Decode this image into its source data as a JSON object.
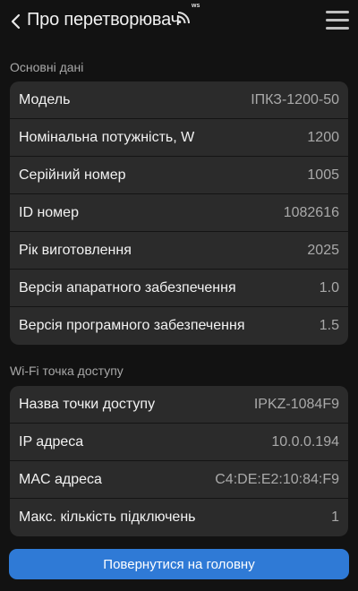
{
  "header": {
    "title": "Про перетворювач",
    "back_icon": "chevron-left-icon",
    "ws_icon": "wifi-websocket-icon",
    "ws_label": "ws",
    "menu_icon": "hamburger-menu-icon"
  },
  "basic": {
    "title": "Основні дані",
    "rows": [
      {
        "label": "Модель",
        "value": "ІПКЗ-1200-50"
      },
      {
        "label": "Номінальна потужність, W",
        "value": "1200"
      },
      {
        "label": "Серійний номер",
        "value": "1005"
      },
      {
        "label": "ID номер",
        "value": "1082616"
      },
      {
        "label": "Рік виготовлення",
        "value": "2025"
      },
      {
        "label": "Версія апаратного забезпечення",
        "value": "1.0"
      },
      {
        "label": "Версія програмного забезпечення",
        "value": "1.5"
      }
    ]
  },
  "wifi": {
    "title": "Wi-Fi точка доступу",
    "rows": [
      {
        "label": "Назва точки доступу",
        "value": "IPKZ-1084F9"
      },
      {
        "label": "IP адреса",
        "value": "10.0.0.194"
      },
      {
        "label": "MAC адреса",
        "value": "C4:DE:E2:10:84:F9"
      },
      {
        "label": "Макс. кількість підключень",
        "value": "1"
      }
    ]
  },
  "footer": {
    "home_button": "Повернутися на головну"
  },
  "colors": {
    "background": "#121212",
    "card": "#2b2b2b",
    "accent": "#2f7ad6"
  }
}
